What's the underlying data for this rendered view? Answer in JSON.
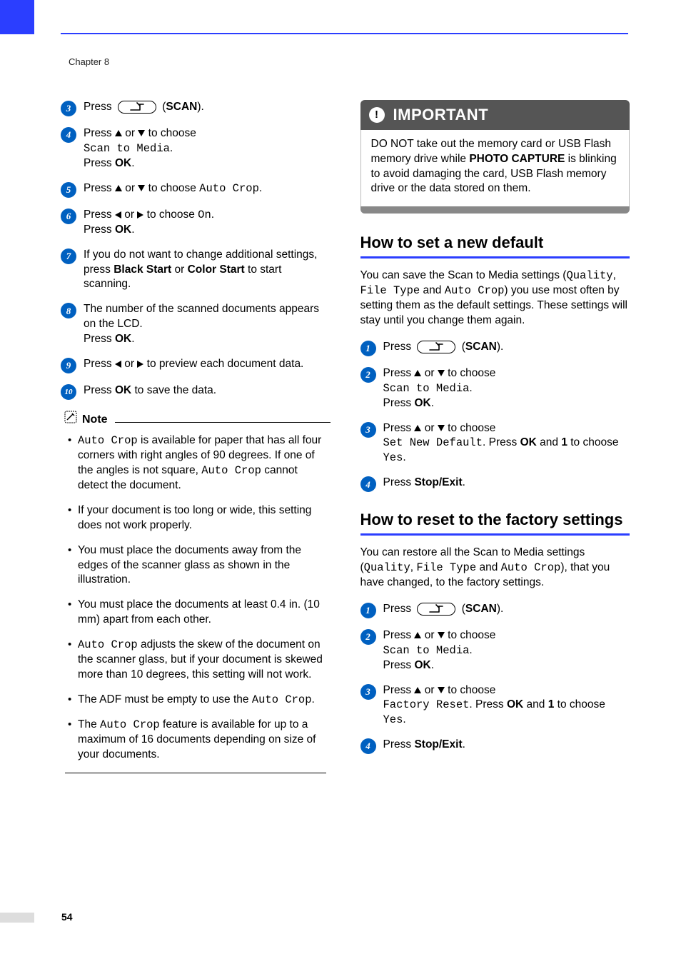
{
  "chapter": "Chapter 8",
  "page_number": "54",
  "scan_label": "SCAN",
  "left_steps": {
    "s3": {
      "press": "Press ",
      "tail": " (",
      "close": ")."
    },
    "s4": {
      "l1a": "Press ",
      "l1b": " or ",
      "l1c": " to choose",
      "mono": "Scan to Media",
      "dot": ".",
      "l3a": "Press ",
      "ok": "OK",
      "l3b": "."
    },
    "s5": {
      "a": "Press ",
      "b": " or ",
      "c": " to choose ",
      "mono": "Auto Crop",
      "dot": "."
    },
    "s6": {
      "a": "Press ",
      "b": " or ",
      "c": " to choose ",
      "mono": "On",
      "dot": ".",
      "d": "Press ",
      "ok": "OK",
      "e": "."
    },
    "s7": {
      "a": "If you do not want to change additional settings, press ",
      "bs": "Black Start",
      "b": " or ",
      "cs": "Color Start",
      "c": " to start scanning."
    },
    "s8": {
      "a": "The number of the scanned documents appears on the LCD.",
      "b": "Press ",
      "ok": "OK",
      "c": "."
    },
    "s9": {
      "a": "Press ",
      "b": " or ",
      "c": " to preview each document data."
    },
    "s10": {
      "a": "Press ",
      "ok": "OK",
      "b": " to save the data."
    }
  },
  "note": {
    "title": "Note",
    "items": [
      {
        "pre": "",
        "mono1": "Auto Crop",
        "mid": " is available for paper that has all four corners with right angles of 90 degrees. If one of the angles is not square, ",
        "mono2": "Auto Crop",
        "post": " cannot detect the document."
      },
      {
        "text": "If your document is too long or wide, this setting does not work properly."
      },
      {
        "text": "You must place the documents away from the edges of the scanner glass as shown in the illustration."
      },
      {
        "text": "You must place the documents at least 0.4 in. (10 mm) apart from each other."
      },
      {
        "pre": "",
        "mono1": "Auto Crop",
        "mid": " adjusts the skew of the document on the scanner glass, but if your document is skewed more than 10 degrees, this setting will not work."
      },
      {
        "pre": "The ADF must be empty to use the ",
        "mono1": "Auto Crop",
        "mid": "."
      },
      {
        "pre": "The ",
        "mono1": "Auto Crop",
        "mid": " feature is available for up to a maximum of 16 documents depending on size of your documents."
      }
    ]
  },
  "important": {
    "title": "IMPORTANT",
    "body_a": "DO NOT take out the memory card or USB Flash memory drive while ",
    "body_bold": "PHOTO CAPTURE",
    "body_b": " is blinking to avoid damaging the card, USB Flash memory drive or the data stored on them."
  },
  "set_default": {
    "heading": "How to set a new default",
    "intro_a": "You can save the Scan to Media settings (",
    "intro_q": "Quality",
    "intro_c1": ", ",
    "intro_ft": "File Type",
    "intro_and": " and ",
    "intro_ac": "Auto Crop",
    "intro_b": ") you use most often by setting them as the default settings. These settings will stay until you change them again.",
    "s1": {
      "press": "Press ",
      "tail": " (",
      "close": ")."
    },
    "s2": {
      "a": "Press ",
      "b": " or ",
      "c": " to choose",
      "mono": "Scan to Media",
      "dot": ".",
      "d": "Press ",
      "ok": "OK",
      "e": "."
    },
    "s3": {
      "a": "Press ",
      "b": " or ",
      "c": " to choose ",
      "mono": "Set New Default",
      "d": ". Press ",
      "ok": "OK",
      "e": " and ",
      "one": "1",
      "f": " to choose ",
      "yes": "Yes",
      "g": "."
    },
    "s4": {
      "a": "Press ",
      "se": "Stop/Exit",
      "b": "."
    }
  },
  "reset": {
    "heading": "How to reset to the factory settings",
    "intro_a": "You can restore all the Scan to Media settings (",
    "intro_q": "Quality",
    "intro_c1": ", ",
    "intro_ft": "File Type",
    "intro_and": " and ",
    "intro_ac": "Auto Crop",
    "intro_b": "), that you have changed, to the factory settings.",
    "s1": {
      "press": "Press ",
      "tail": " (",
      "close": ")."
    },
    "s2": {
      "a": "Press ",
      "b": " or ",
      "c": " to choose",
      "mono": "Scan to Media",
      "dot": ".",
      "d": "Press ",
      "ok": "OK",
      "e": "."
    },
    "s3": {
      "a": "Press ",
      "b": " or ",
      "c": " to choose ",
      "mono": "Factory Reset",
      "d": ". Press ",
      "ok": "OK",
      "e": " and ",
      "one": "1",
      "f": " to choose ",
      "yes": "Yes",
      "g": "."
    },
    "s4": {
      "a": "Press ",
      "se": "Stop/Exit",
      "b": "."
    }
  }
}
